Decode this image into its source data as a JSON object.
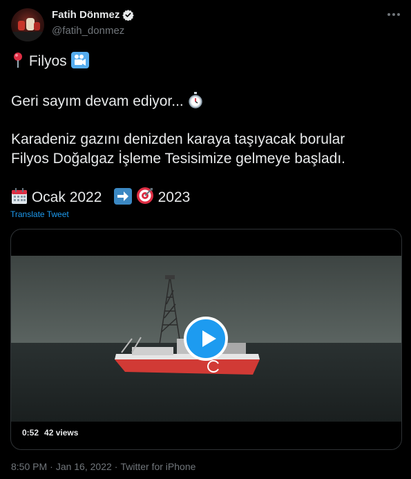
{
  "author": {
    "name": "Fatih Dönmez",
    "handle": "@fatih_donmez",
    "verified": true
  },
  "tweet": {
    "line1": "Filyos",
    "line2": "Geri sayım devam ediyor...",
    "line3": "Karadeniz gazını denizden karaya taşıyacak borular",
    "line4": "Filyos Doğalgaz İşleme Tesisimize gelmeye başladı.",
    "date_from": "Ocak 2022",
    "date_to": "2023",
    "translate_link": "Translate Tweet"
  },
  "icons": [
    "more-options-icon",
    "verified-badge-icon",
    "round-pushpin-icon",
    "movie-camera-icon",
    "stopwatch-icon",
    "calendar-icon",
    "right-arrow-icon",
    "target-icon",
    "play-icon"
  ],
  "video": {
    "duration": "0:52",
    "views": "42 views"
  },
  "meta": {
    "time": "8:50 PM",
    "sep1": "·",
    "date": "Jan 16, 2022",
    "sep2": "·",
    "source": "Twitter for iPhone"
  },
  "colors": {
    "background": "#000000",
    "text": "#e7e9ea",
    "muted": "#71767b",
    "accent": "#1d9bf0"
  }
}
